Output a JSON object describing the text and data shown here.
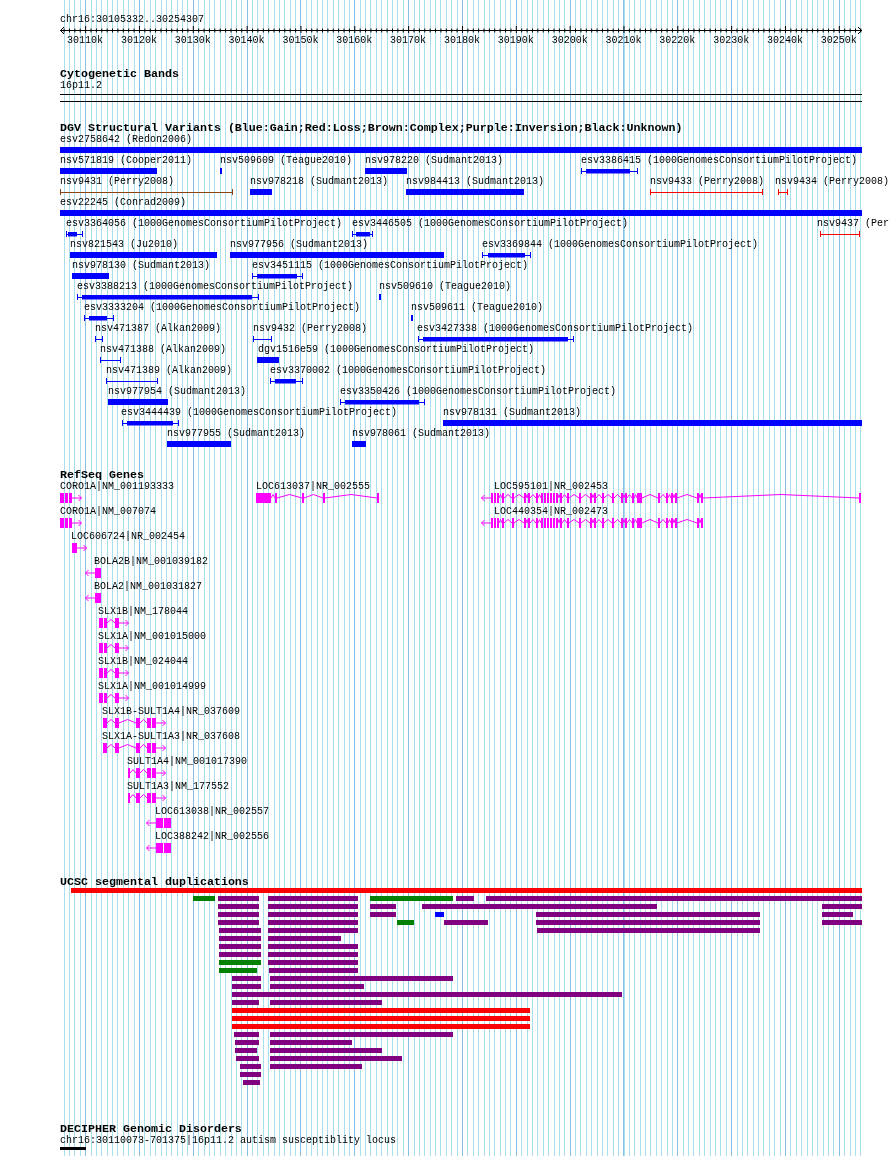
{
  "ruler": {
    "range": "chr16:30105332..30254307",
    "ticks": [
      "30110k",
      "30120k",
      "30130k",
      "30140k",
      "30150k",
      "30160k",
      "30170k",
      "30180k",
      "30190k",
      "30200k",
      "30210k",
      "30220k",
      "30230k",
      "30240k",
      "30250k"
    ]
  },
  "cytogenetic_bands": {
    "title": "Cytogenetic Bands",
    "bands": [
      {
        "label": "16p11.2"
      }
    ]
  },
  "dgv": {
    "title": "DGV Structural Variants (Blue:Gain;Red:Loss;Brown:Complex;Purple:Inversion;Black:Unknown)",
    "rows": [
      {
        "features": [
          {
            "label": "esv2758642 (Redon2006)",
            "kind": "bar",
            "color": "#0000ff"
          }
        ]
      },
      {
        "features": [
          {
            "label": "nsv571819 (Cooper2011)",
            "kind": "bar",
            "color": "#0000ff"
          },
          {
            "label": "nsv509609 (Teague2010)",
            "kind": "bar",
            "color": "#0000ff"
          },
          {
            "label": "nsv978220 (Sudmant2013)",
            "kind": "bar",
            "color": "#0000ff"
          },
          {
            "label": "esv3386415 (1000GenomesConsortiumPilotProject)",
            "kind": "capped-bar",
            "color": "#0000ff"
          }
        ]
      },
      {
        "features": [
          {
            "label": "nsv9431 (Perry2008)",
            "kind": "capped-line",
            "color": "#8b4513"
          },
          {
            "label": "nsv978218 (Sudmant2013)",
            "kind": "bar",
            "color": "#0000ff"
          },
          {
            "label": "nsv984413 (Sudmant2013)",
            "kind": "bar",
            "color": "#0000ff"
          },
          {
            "label": "nsv9433 (Perry2008)",
            "kind": "capped-line",
            "color": "#ff0000"
          },
          {
            "label": "nsv9434 (Perry2008)",
            "kind": "capped-line",
            "color": "#ff0000"
          }
        ]
      },
      {
        "features": [
          {
            "label": "esv22245 (Conrad2009)",
            "kind": "bar",
            "color": "#0000ff"
          }
        ]
      },
      {
        "features": [
          {
            "label": "esv3364056 (1000GenomesConsortiumPilotProject)",
            "kind": "capped-bar",
            "color": "#0000ff"
          },
          {
            "label": "esv3446505 (1000GenomesConsortiumPilotProject)",
            "kind": "capped-bar",
            "color": "#0000ff"
          },
          {
            "label": "nsv9437 (Per",
            "kind": "capped-line",
            "color": "#ff0000"
          }
        ]
      },
      {
        "features": [
          {
            "label": "nsv821543 (Ju2010)",
            "kind": "bar",
            "color": "#0000ff"
          },
          {
            "label": "nsv977956 (Sudmant2013)",
            "kind": "bar",
            "color": "#0000ff"
          },
          {
            "label": "esv3369844 (1000GenomesConsortiumPilotProject)",
            "kind": "capped-bar",
            "color": "#0000ff"
          }
        ]
      },
      {
        "features": [
          {
            "label": "nsv978130 (Sudmant2013)",
            "kind": "bar",
            "color": "#0000ff"
          },
          {
            "label": "esv3451115 (1000GenomesConsortiumPilotProject)",
            "kind": "capped-bar",
            "color": "#0000ff"
          }
        ]
      },
      {
        "features": [
          {
            "label": "esv3388213 (1000GenomesConsortiumPilotProject)",
            "kind": "capped-bar",
            "color": "#0000ff"
          },
          {
            "label": "nsv509610 (Teague2010)",
            "kind": "bar",
            "color": "#0000ff"
          }
        ]
      },
      {
        "features": [
          {
            "label": "esv3333204 (1000GenomesConsortiumPilotProject)",
            "kind": "capped-bar",
            "color": "#0000ff"
          },
          {
            "label": "nsv509611 (Teague2010)",
            "kind": "bar",
            "color": "#0000ff"
          }
        ]
      },
      {
        "features": [
          {
            "label": "nsv471387 (Alkan2009)",
            "kind": "capped-line",
            "color": "#0000ff"
          },
          {
            "label": "nsv9432 (Perry2008)",
            "kind": "capped-line",
            "color": "#0000ff"
          },
          {
            "label": "esv3427338 (1000GenomesConsortiumPilotProject)",
            "kind": "capped-bar",
            "color": "#0000ff"
          }
        ]
      },
      {
        "features": [
          {
            "label": "nsv471388 (Alkan2009)",
            "kind": "capped-line",
            "color": "#0000ff"
          },
          {
            "label": "dgv1516e59 (1000GenomesConsortiumPilotProject)",
            "kind": "bar",
            "color": "#0000ff"
          }
        ]
      },
      {
        "features": [
          {
            "label": "nsv471389 (Alkan2009)",
            "kind": "capped-line",
            "color": "#0000ff"
          },
          {
            "label": "esv3370002 (1000GenomesConsortiumPilotProject)",
            "kind": "capped-bar",
            "color": "#0000ff"
          }
        ]
      },
      {
        "features": [
          {
            "label": "nsv977954 (Sudmant2013)",
            "kind": "bar",
            "color": "#0000ff"
          },
          {
            "label": "esv3350426 (1000GenomesConsortiumPilotProject)",
            "kind": "capped-bar",
            "color": "#0000ff"
          }
        ]
      },
      {
        "features": [
          {
            "label": "esv3444439 (1000GenomesConsortiumPilotProject)",
            "kind": "capped-bar",
            "color": "#0000ff"
          },
          {
            "label": "nsv978131 (Sudmant2013)",
            "kind": "bar",
            "color": "#0000ff"
          }
        ]
      },
      {
        "features": [
          {
            "label": "nsv977955 (Sudmant2013)",
            "kind": "bar",
            "color": "#0000ff"
          },
          {
            "label": "nsv978061 (Sudmant2013)",
            "kind": "bar",
            "color": "#0000ff"
          }
        ]
      }
    ]
  },
  "refseq": {
    "title": "RefSeq Genes",
    "rows": [
      {
        "genes": [
          {
            "label": "CORO1A|NM_001193333",
            "forward_arrow": true,
            "reverse_arrow": false
          },
          {
            "label": "LOC613037|NR_002555",
            "forward_arrow": false,
            "reverse_arrow": false
          },
          {
            "label": "LOC595101|NR_002453",
            "forward_arrow": false,
            "reverse_arrow": true
          }
        ]
      },
      {
        "genes": [
          {
            "label": "CORO1A|NM_007074",
            "forward_arrow": true,
            "reverse_arrow": false
          },
          {
            "label": "LOC440354|NR_002473",
            "forward_arrow": false,
            "reverse_arrow": true
          }
        ]
      },
      {
        "genes": [
          {
            "label": "LOC606724|NR_002454",
            "forward_arrow": true,
            "reverse_arrow": false
          }
        ]
      },
      {
        "genes": [
          {
            "label": "BOLA2B|NM_001039182",
            "forward_arrow": false,
            "reverse_arrow": true
          }
        ]
      },
      {
        "genes": [
          {
            "label": "BOLA2|NM_001031827",
            "forward_arrow": false,
            "reverse_arrow": true
          }
        ]
      },
      {
        "genes": [
          {
            "label": "SLX1B|NM_178044",
            "forward_arrow": true,
            "reverse_arrow": false
          }
        ]
      },
      {
        "genes": [
          {
            "label": "SLX1A|NM_001015000",
            "forward_arrow": true,
            "reverse_arrow": false
          }
        ]
      },
      {
        "genes": [
          {
            "label": "SLX1B|NM_024044",
            "forward_arrow": true,
            "reverse_arrow": false
          }
        ]
      },
      {
        "genes": [
          {
            "label": "SLX1A|NM_001014999",
            "forward_arrow": true,
            "reverse_arrow": false
          }
        ]
      },
      {
        "genes": [
          {
            "label": "SLX1B-SULT1A4|NR_037609",
            "forward_arrow": true,
            "reverse_arrow": false
          }
        ]
      },
      {
        "genes": [
          {
            "label": "SLX1A-SULT1A3|NR_037608",
            "forward_arrow": true,
            "reverse_arrow": false
          }
        ]
      },
      {
        "genes": [
          {
            "label": "SULT1A4|NM_001017390",
            "forward_arrow": true,
            "reverse_arrow": false
          }
        ]
      },
      {
        "genes": [
          {
            "label": "SULT1A3|NM_177552",
            "forward_arrow": true,
            "reverse_arrow": false
          }
        ]
      },
      {
        "genes": [
          {
            "label": "LOC613038|NR_002557",
            "forward_arrow": false,
            "reverse_arrow": true
          }
        ]
      },
      {
        "genes": [
          {
            "label": "LOC388242|NR_002556",
            "forward_arrow": false,
            "reverse_arrow": true
          }
        ]
      }
    ]
  },
  "segmental_duplications": {
    "title": "UCSC segmental duplications",
    "rows": [
      {
        "features": [
          {
            "color": "#ff0000"
          }
        ]
      },
      {
        "features": [
          {
            "color": "#008000"
          },
          {
            "color": "#800080"
          },
          {
            "color": "#800080"
          },
          {
            "color": "#008000"
          },
          {
            "color": "#800080"
          },
          {
            "color": "#800080"
          }
        ]
      },
      {
        "features": [
          {
            "color": "#800080"
          },
          {
            "color": "#800080"
          },
          {
            "color": "#800080"
          },
          {
            "color": "#800080"
          },
          {
            "color": "#800080"
          }
        ]
      },
      {
        "features": [
          {
            "color": "#800080"
          },
          {
            "color": "#800080"
          },
          {
            "color": "#800080"
          },
          {
            "color": "#0000ff"
          },
          {
            "color": "#800080"
          },
          {
            "color": "#800080"
          }
        ]
      },
      {
        "features": [
          {
            "color": "#800080"
          },
          {
            "color": "#800080"
          },
          {
            "color": "#008000"
          },
          {
            "color": "#800080"
          },
          {
            "color": "#800080"
          },
          {
            "color": "#800080"
          }
        ]
      },
      {
        "features": [
          {
            "color": "#800080"
          },
          {
            "color": "#800080"
          },
          {
            "color": "#800080"
          }
        ]
      },
      {
        "features": [
          {
            "color": "#800080"
          },
          {
            "color": "#800080"
          }
        ]
      },
      {
        "features": [
          {
            "color": "#800080"
          },
          {
            "color": "#800080"
          }
        ]
      },
      {
        "features": [
          {
            "color": "#800080"
          },
          {
            "color": "#800080"
          }
        ]
      },
      {
        "features": [
          {
            "color": "#008000"
          },
          {
            "color": "#800080"
          }
        ]
      },
      {
        "features": [
          {
            "color": "#008000"
          },
          {
            "color": "#800080"
          }
        ]
      },
      {
        "features": [
          {
            "color": "#800080"
          },
          {
            "color": "#800080"
          }
        ]
      },
      {
        "features": [
          {
            "color": "#800080"
          },
          {
            "color": "#800080"
          }
        ]
      },
      {
        "features": [
          {
            "color": "#800080"
          }
        ]
      },
      {
        "features": [
          {
            "color": "#800080"
          },
          {
            "color": "#800080"
          }
        ]
      },
      {
        "features": [
          {
            "color": "#ff0000"
          }
        ]
      },
      {
        "features": [
          {
            "color": "#ff0000"
          }
        ]
      },
      {
        "features": [
          {
            "color": "#ff0000"
          }
        ]
      },
      {
        "features": [
          {
            "color": "#800080"
          },
          {
            "color": "#800080"
          }
        ]
      },
      {
        "features": [
          {
            "color": "#800080"
          },
          {
            "color": "#800080"
          }
        ]
      },
      {
        "features": [
          {
            "color": "#800080"
          },
          {
            "color": "#800080"
          }
        ]
      },
      {
        "features": [
          {
            "color": "#800080"
          },
          {
            "color": "#800080"
          }
        ]
      },
      {
        "features": [
          {
            "color": "#800080"
          },
          {
            "color": "#800080"
          }
        ]
      },
      {
        "features": [
          {
            "color": "#800080"
          }
        ]
      },
      {
        "features": [
          {
            "color": "#800080"
          }
        ]
      }
    ]
  },
  "decipher": {
    "title": "DECIPHER Genomic Disorders",
    "features": [
      {
        "label": "chr16:30110073-701375|16p11.2 autism susceptiblity locus"
      }
    ]
  }
}
